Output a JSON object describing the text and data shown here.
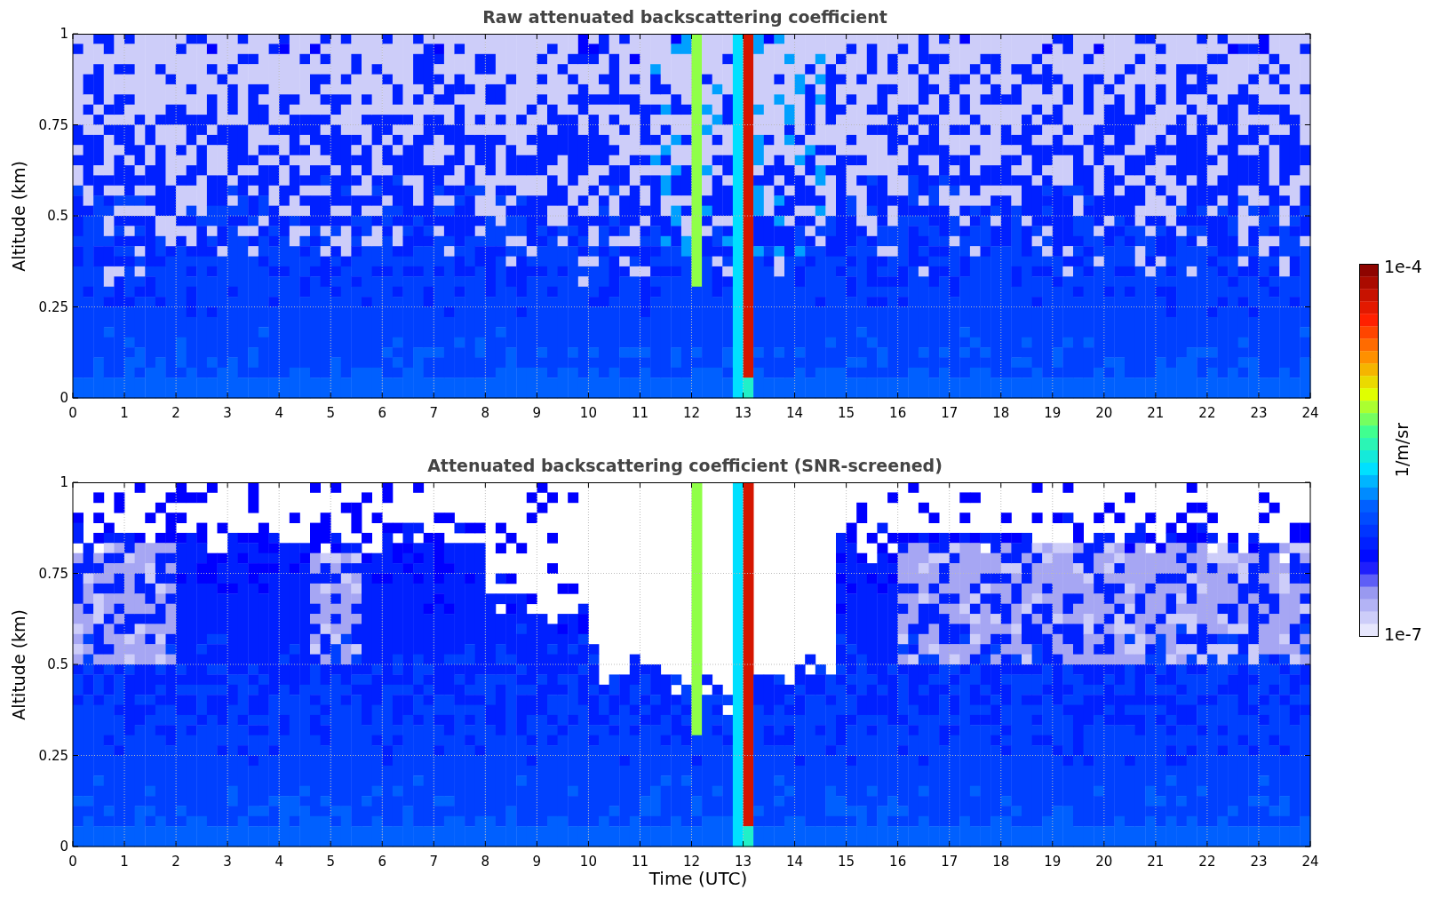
{
  "panels": [
    {
      "title": "Raw attenuated backscattering coefficient",
      "ylabel": "Altitude (km)",
      "kind": "raw",
      "yticks": [
        "1",
        "0.75",
        "0.5",
        "0.25",
        "0"
      ],
      "xticks": [
        "0",
        "1",
        "2",
        "3",
        "4",
        "5",
        "6",
        "7",
        "8",
        "9",
        "10",
        "11",
        "12",
        "13",
        "14",
        "15",
        "16",
        "17",
        "18",
        "19",
        "20",
        "21",
        "22",
        "23",
        "24"
      ]
    },
    {
      "title": "Attenuated backscattering coefficient (SNR-screened)",
      "ylabel": "Altitude (km)",
      "kind": "screened",
      "yticks": [
        "1",
        "0.75",
        "0.5",
        "0.25",
        "0"
      ],
      "xticks": [
        "0",
        "1",
        "2",
        "3",
        "4",
        "5",
        "6",
        "7",
        "8",
        "9",
        "10",
        "11",
        "12",
        "13",
        "14",
        "15",
        "16",
        "17",
        "18",
        "19",
        "20",
        "21",
        "22",
        "23",
        "24"
      ],
      "xlabel": "Time (UTC)"
    }
  ],
  "colorbar": {
    "max_label": "1e-4",
    "min_label": "1e-7",
    "label": "1/m/sr"
  }
}
